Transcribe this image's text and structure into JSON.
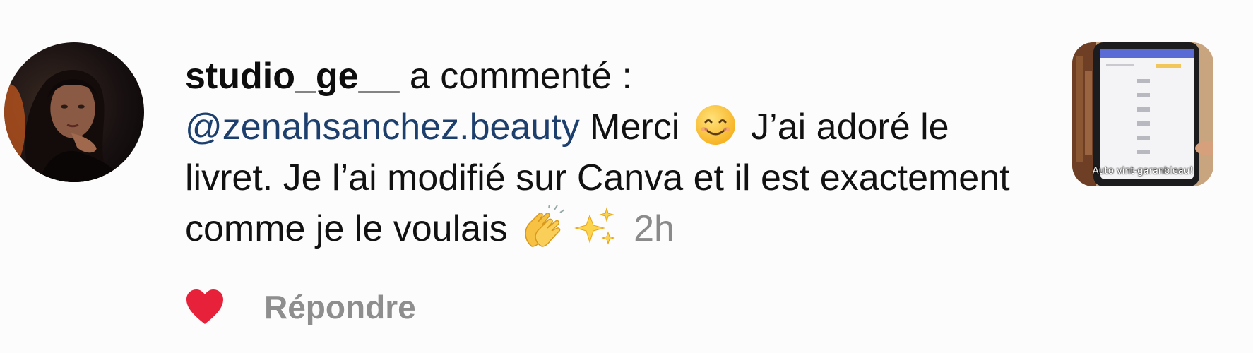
{
  "comment": {
    "username": "studio_ge__",
    "action_text": "a commenté :",
    "mention": "@zenahsanchez.beauty",
    "text_part1": " Merci ",
    "text_part2": " J’ai adoré le livret. Je l’ai modifié sur Canva et il est exactement comme je le voulais ",
    "timestamp": "2h",
    "emojis": [
      "smiling-face-emoji",
      "clapping-hands-emoji",
      "sparkles-emoji"
    ]
  },
  "actions": {
    "like_icon": "heart-icon",
    "like_color": "#e8213a",
    "reply_label": "Répondre"
  },
  "thumbnail": {
    "caption": "Auto vint-garanbleau!"
  },
  "colors": {
    "mention": "#1d3f6e",
    "timestamp": "#8a8a8a",
    "reply": "#8e8e8e"
  }
}
